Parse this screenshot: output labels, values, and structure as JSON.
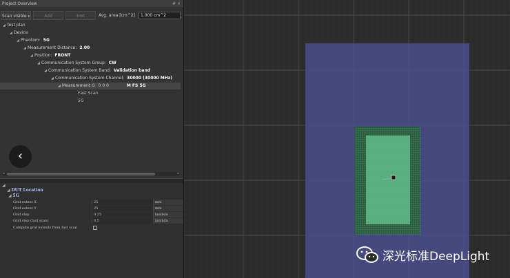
{
  "panel": {
    "title": "Project Overview",
    "title_icons": "# ×"
  },
  "toolbar": {
    "scan_visible": "Scan visible",
    "add": "Add",
    "edit": "Edit",
    "avg_area_label": "Avg. area [cm^2]",
    "avg_area_value": "1.000 cm^2"
  },
  "tree": [
    {
      "label": "Test plan",
      "value": "",
      "level": 0
    },
    {
      "label": "Device",
      "value": "",
      "level": 1
    },
    {
      "label": "Phantom:",
      "value": "5G",
      "level": 2
    },
    {
      "label": "Measurement Distance:",
      "value": "2.00",
      "level": 3
    },
    {
      "label": "Position:",
      "value": "FRONT",
      "level": 4
    },
    {
      "label": "Communication System Group:",
      "value": "CW",
      "level": 5
    },
    {
      "label": "Communication System Band:",
      "value": "Validation band",
      "level": 6
    },
    {
      "label": "Communication System Channel:",
      "value": "30000 (30000 MHz)",
      "level": 7
    },
    {
      "label": "Measurement G",
      "value": "0      0      0",
      "extra": "M  FS 5G",
      "level": 8,
      "selected": true
    },
    {
      "label": "Fast Scan",
      "value": "",
      "level": 9,
      "italic": true
    },
    {
      "label": "5G",
      "value": "",
      "level": 9,
      "italic": true
    }
  ],
  "back_button": "‹",
  "properties": {
    "section": "DUT Location",
    "subsection": "5G",
    "rows": [
      {
        "key": "Grid extent X",
        "value": "25",
        "unit": "mm"
      },
      {
        "key": "Grid extent Y",
        "value": "25",
        "unit": "mm"
      },
      {
        "key": "Grid step",
        "value": "0.25",
        "unit": "lambda"
      },
      {
        "key": "Grid step (fast scan)",
        "value": "0.5",
        "unit": "lambda"
      },
      {
        "key": "Compute grid extents from fast scan",
        "value": "",
        "unit": "",
        "checkbox": true
      }
    ]
  },
  "watermark": {
    "text": "深光标准DeepLight"
  },
  "colors": {
    "viewport_bg": "#2b2b2b",
    "phantom_area": "#4a4e8c",
    "scan_area_green": "#5fb784",
    "dot_grid_green": "#3a8f4e"
  }
}
